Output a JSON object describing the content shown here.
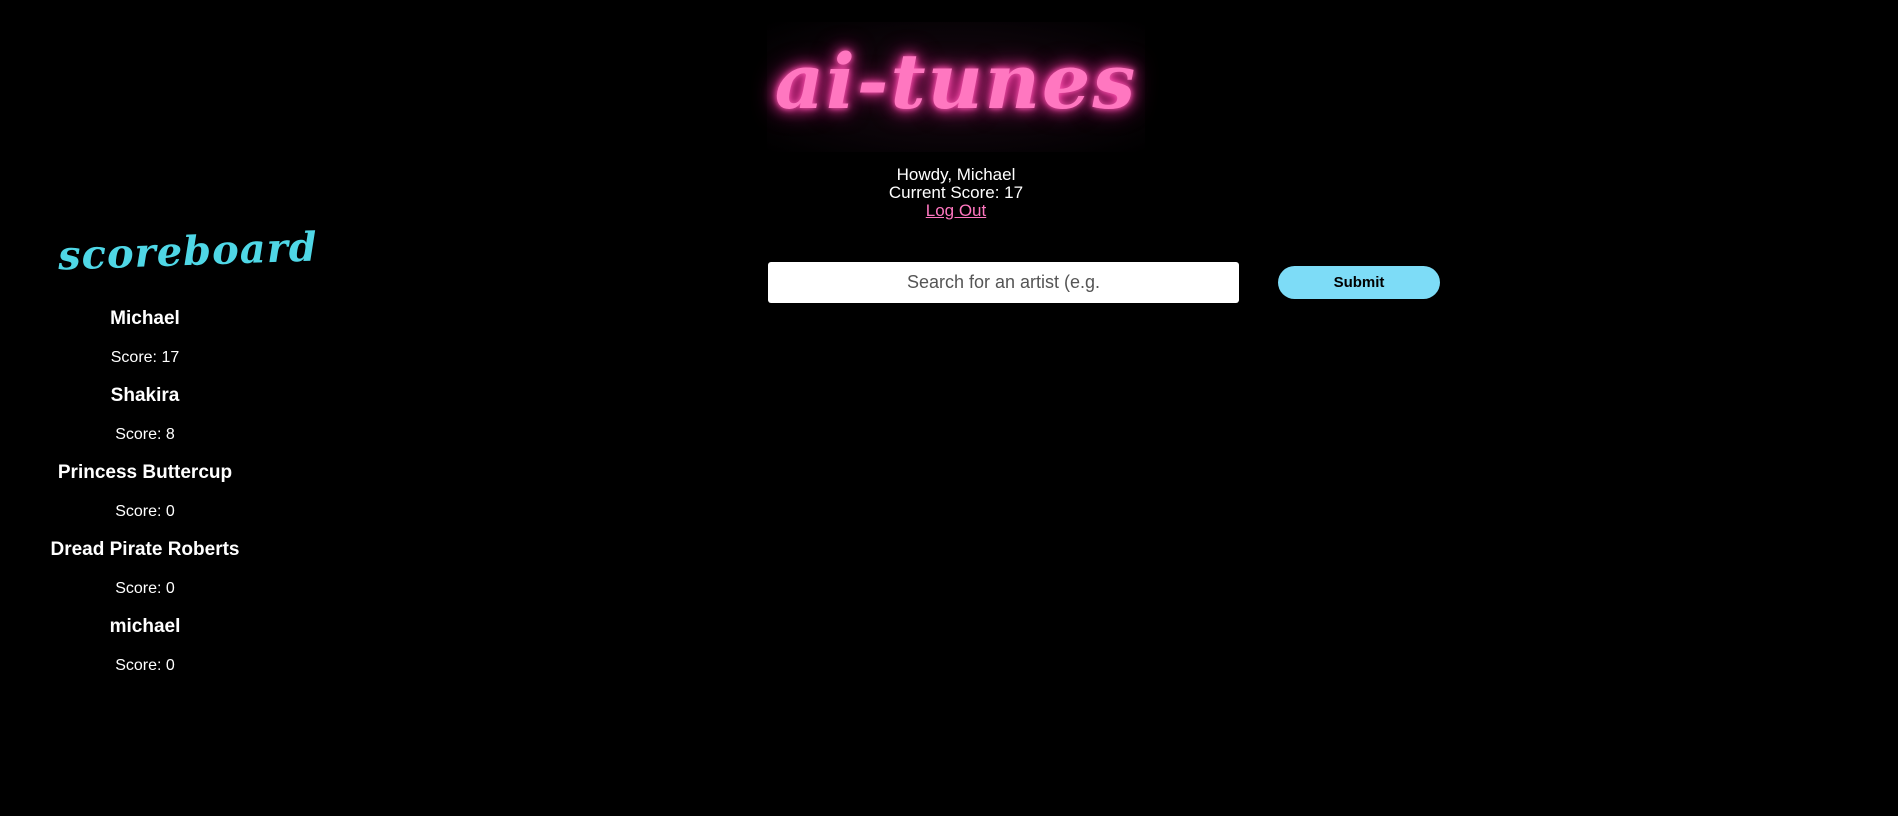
{
  "logo": {
    "text": "ai-tunes"
  },
  "greeting": {
    "howdy": "Howdy, Michael",
    "current_score": "Current Score: 17",
    "logout": "Log Out"
  },
  "search": {
    "placeholder": "Search for an artist (e.g.",
    "value": "",
    "submit_label": "Submit"
  },
  "scoreboard": {
    "title": "scoreboard",
    "entries": [
      {
        "name": "Michael",
        "score": "Score: 17"
      },
      {
        "name": "Shakira",
        "score": "Score: 8"
      },
      {
        "name": "Princess Buttercup",
        "score": "Score: 0"
      },
      {
        "name": "Dread Pirate Roberts",
        "score": "Score: 0"
      },
      {
        "name": "michael",
        "score": "Score: 0"
      }
    ]
  },
  "colors": {
    "background": "#000000",
    "logo_pink": "#ff77c0",
    "scoreboard_cyan": "#4fd7e6",
    "submit_blue": "#7ddcf7"
  }
}
